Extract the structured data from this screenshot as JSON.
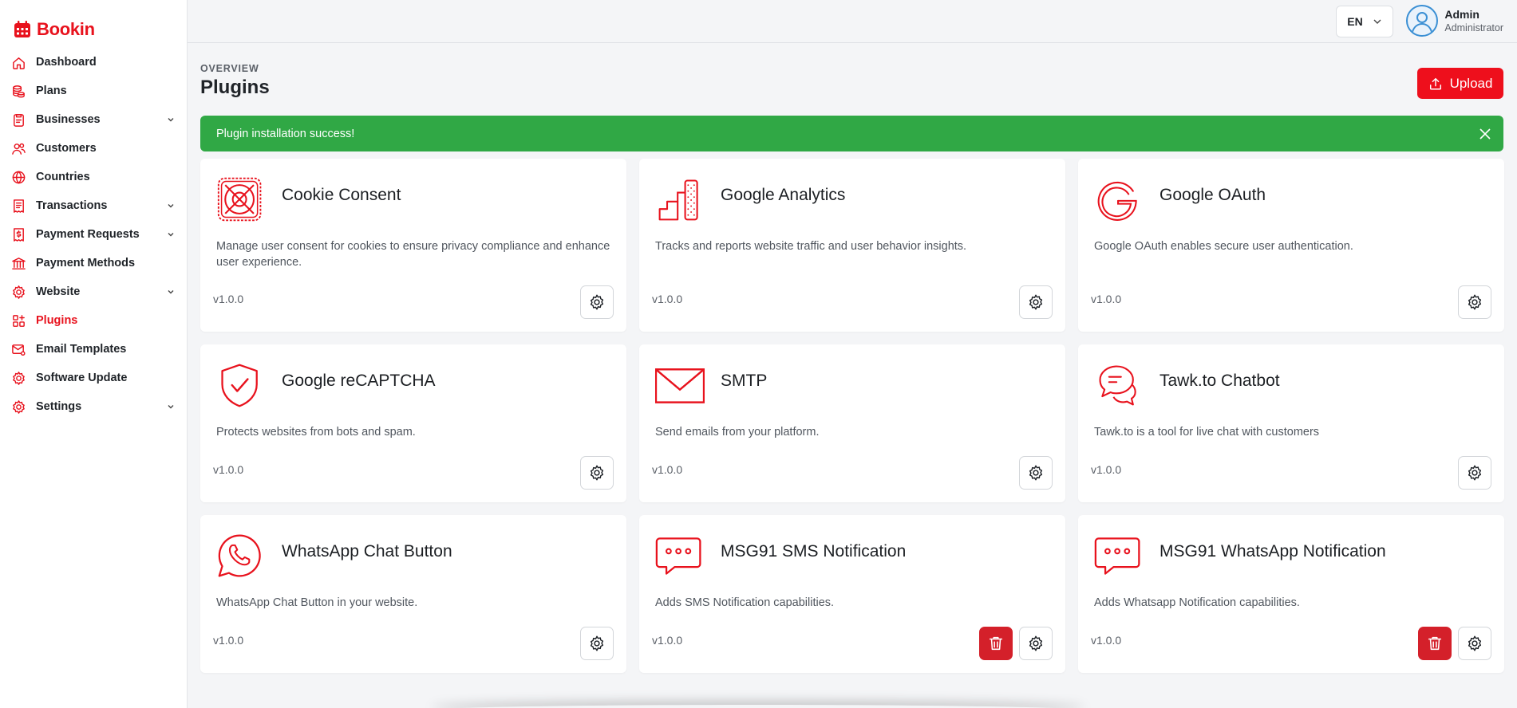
{
  "brand": {
    "name": "Bookin"
  },
  "sidebar": {
    "items": [
      {
        "label": "Dashboard",
        "icon": "home-icon",
        "active": false,
        "expandable": false
      },
      {
        "label": "Plans",
        "icon": "coins-icon",
        "active": false,
        "expandable": false
      },
      {
        "label": "Businesses",
        "icon": "clipboard-icon",
        "active": false,
        "expandable": true
      },
      {
        "label": "Customers",
        "icon": "users-icon",
        "active": false,
        "expandable": false
      },
      {
        "label": "Countries",
        "icon": "globe-icon",
        "active": false,
        "expandable": false
      },
      {
        "label": "Transactions",
        "icon": "receipt-icon",
        "active": false,
        "expandable": true
      },
      {
        "label": "Payment Requests",
        "icon": "receipt-dollar-icon",
        "active": false,
        "expandable": true
      },
      {
        "label": "Payment Methods",
        "icon": "bank-icon",
        "active": false,
        "expandable": false
      },
      {
        "label": "Website",
        "icon": "gear-icon",
        "active": false,
        "expandable": true
      },
      {
        "label": "Plugins",
        "icon": "apps-icon",
        "active": true,
        "expandable": false
      },
      {
        "label": "Email Templates",
        "icon": "mail-gear-icon",
        "active": false,
        "expandable": false
      },
      {
        "label": "Software Update",
        "icon": "refresh-gear-icon",
        "active": false,
        "expandable": false
      },
      {
        "label": "Settings",
        "icon": "gear-icon",
        "active": false,
        "expandable": true
      }
    ]
  },
  "topbar": {
    "language": "EN",
    "user": {
      "name": "Admin",
      "role": "Administrator"
    }
  },
  "header": {
    "overline": "OVERVIEW",
    "title": "Plugins",
    "upload_label": "Upload"
  },
  "alert": {
    "message": "Plugin installation success!"
  },
  "plugins": [
    {
      "name": "Cookie Consent",
      "description": "Manage user consent for cookies to ensure privacy compliance and enhance user experience.",
      "version": "v1.0.0",
      "icon": "cookie-consent-icon",
      "deletable": false
    },
    {
      "name": "Google Analytics",
      "description": "Tracks and reports website traffic and user behavior insights.",
      "version": "v1.0.0",
      "icon": "analytics-icon",
      "deletable": false
    },
    {
      "name": "Google OAuth",
      "description": "Google OAuth enables secure user authentication.",
      "version": "v1.0.0",
      "icon": "google-icon",
      "deletable": false
    },
    {
      "name": "Google reCAPTCHA",
      "description": "Protects websites from bots and spam.",
      "version": "v1.0.0",
      "icon": "shield-check-icon",
      "deletable": false
    },
    {
      "name": "SMTP",
      "description": "Send emails from your platform.",
      "version": "v1.0.0",
      "icon": "envelope-icon",
      "deletable": false
    },
    {
      "name": "Tawk.to Chatbot",
      "description": "Tawk.to is a tool for live chat with customers",
      "version": "v1.0.0",
      "icon": "chat-bubbles-icon",
      "deletable": false
    },
    {
      "name": "WhatsApp Chat Button",
      "description": "WhatsApp Chat Button in your website.",
      "version": "v1.0.0",
      "icon": "whatsapp-icon",
      "deletable": false
    },
    {
      "name": "MSG91 SMS Notification",
      "description": "Adds SMS Notification capabilities.",
      "version": "v1.0.0",
      "icon": "sms-icon",
      "deletable": true
    },
    {
      "name": "MSG91 WhatsApp Notification",
      "description": "Adds Whatsapp Notification capabilities.",
      "version": "v1.0.0",
      "icon": "sms-icon",
      "deletable": true
    }
  ],
  "colors": {
    "brand": "#e8121d",
    "success": "#30a845",
    "danger": "#d4202a"
  }
}
